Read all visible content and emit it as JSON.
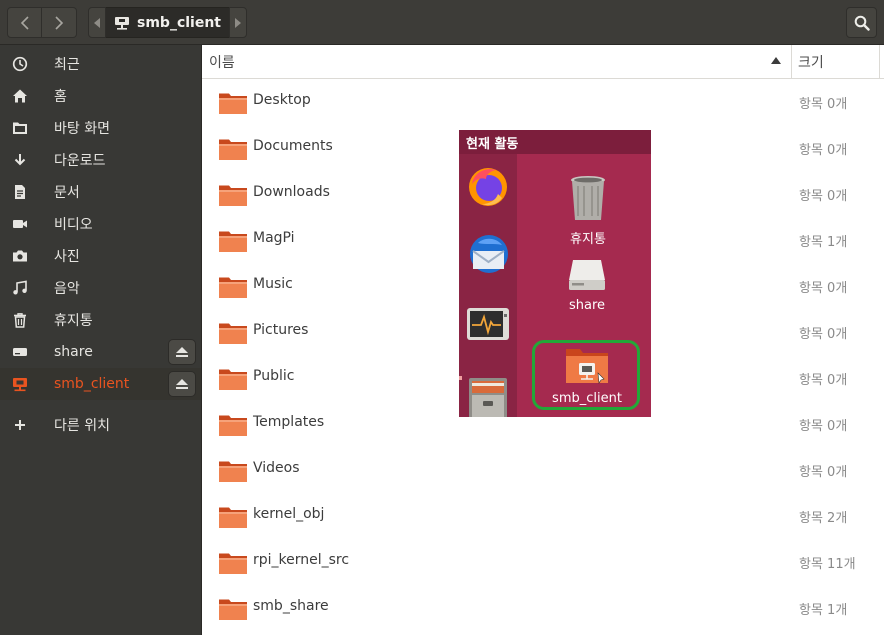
{
  "header": {
    "path_crumb": "smb_client",
    "icons": {
      "back": "chevron-left-icon",
      "forward": "chevron-right-icon",
      "search": "search-icon"
    }
  },
  "sidebar": {
    "items": [
      {
        "label": "최근",
        "icon": "clock-icon"
      },
      {
        "label": "홈",
        "icon": "home-icon"
      },
      {
        "label": "바탕 화면",
        "icon": "desktop-folder-icon"
      },
      {
        "label": "다운로드",
        "icon": "download-icon"
      },
      {
        "label": "문서",
        "icon": "document-icon"
      },
      {
        "label": "비디오",
        "icon": "video-icon"
      },
      {
        "label": "사진",
        "icon": "camera-icon"
      },
      {
        "label": "음악",
        "icon": "music-icon"
      },
      {
        "label": "휴지통",
        "icon": "trash-icon"
      },
      {
        "label": "share",
        "icon": "drive-icon",
        "eject": true
      },
      {
        "label": "smb_client",
        "icon": "network-folder-icon",
        "eject": true,
        "active": true
      },
      {
        "label": "다른 위치",
        "icon": "plus-icon"
      }
    ],
    "accent_color": "#e95420"
  },
  "columns": {
    "name": "이름",
    "size": "크기"
  },
  "files": [
    {
      "name": "Desktop",
      "size": "항목 0개"
    },
    {
      "name": "Documents",
      "size": "항목 0개"
    },
    {
      "name": "Downloads",
      "size": "항목 0개"
    },
    {
      "name": "MagPi",
      "size": "항목 1개"
    },
    {
      "name": "Music",
      "size": "항목 0개"
    },
    {
      "name": "Pictures",
      "size": "항목 0개"
    },
    {
      "name": "Public",
      "size": "항목 0개"
    },
    {
      "name": "Templates",
      "size": "항목 0개"
    },
    {
      "name": "Videos",
      "size": "항목 0개"
    },
    {
      "name": "kernel_obj",
      "size": "항목 2개"
    },
    {
      "name": "rpi_kernel_src",
      "size": "항목 11개"
    },
    {
      "name": "smb_share",
      "size": "항목 1개"
    }
  ],
  "overlay": {
    "title": "현재 활동",
    "dock_apps": [
      "firefox-icon",
      "thunderbird-icon",
      "system-monitor-icon",
      "file-cabinet-icon"
    ],
    "desktop_icons": [
      {
        "label": "휴지통",
        "icon": "trash-icon"
      },
      {
        "label": "share",
        "icon": "drive-icon"
      },
      {
        "label": "smb_client",
        "icon": "network-folder-icon",
        "highlighted": true
      }
    ],
    "highlight_color": "#22a838",
    "background_color": "#a52a4f"
  }
}
